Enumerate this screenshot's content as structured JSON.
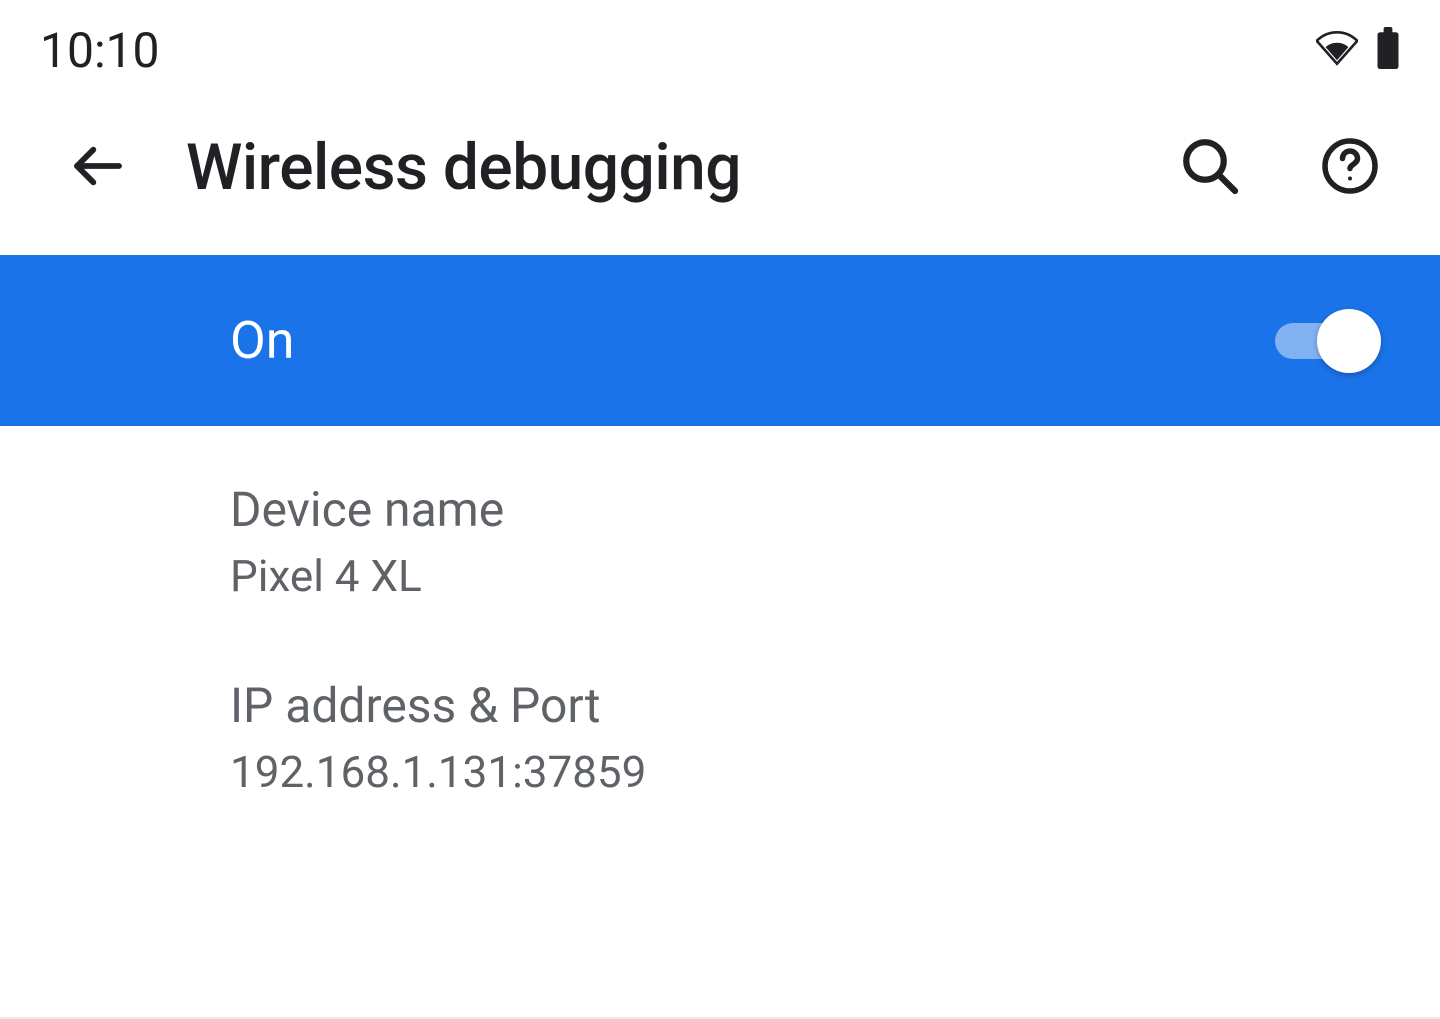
{
  "status_bar": {
    "time": "10:10"
  },
  "app_bar": {
    "title": "Wireless debugging"
  },
  "toggle": {
    "label": "On",
    "state": true
  },
  "settings": [
    {
      "label": "Device name",
      "value": "Pixel 4 XL"
    },
    {
      "label": "IP address & Port",
      "value": "192.168.1.131:37859"
    }
  ]
}
